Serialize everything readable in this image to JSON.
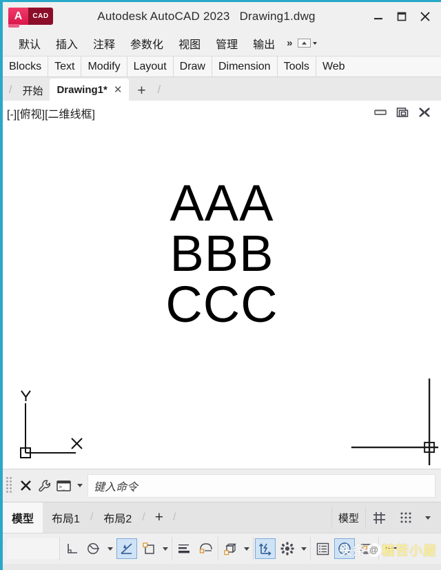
{
  "window": {
    "logo_a": "A",
    "logo_cad": "CAD",
    "app_title": "Autodesk AutoCAD 2023",
    "document_title": "Drawing1.dwg",
    "minimize_label": "minimize",
    "maximize_label": "maximize",
    "close_label": "close"
  },
  "ribbon": {
    "tabs": [
      {
        "label": "默认"
      },
      {
        "label": "插入"
      },
      {
        "label": "注释"
      },
      {
        "label": "参数化"
      },
      {
        "label": "视图"
      },
      {
        "label": "管理"
      },
      {
        "label": "输出"
      }
    ],
    "overflow": "»",
    "panels": [
      {
        "label": "Blocks"
      },
      {
        "label": "Text"
      },
      {
        "label": "Modify"
      },
      {
        "label": "Layout"
      },
      {
        "label": "Draw"
      },
      {
        "label": "Dimension"
      },
      {
        "label": "Tools"
      },
      {
        "label": "Web"
      }
    ]
  },
  "file_tabs": {
    "slash": "/",
    "start_tab": "开始",
    "active_tab": "Drawing1*",
    "close_glyph": "✕",
    "add_glyph": "+"
  },
  "viewport": {
    "label": "[-][俯视][二维线框]",
    "controls": [
      "viewport-minimize",
      "viewport-restore",
      "viewport-close"
    ]
  },
  "drawing": {
    "texts": [
      "AAA",
      "BBB",
      "CCC"
    ],
    "ucs": {
      "x_label": "X",
      "y_label": "Y"
    }
  },
  "command_line": {
    "close_glyph": "✕",
    "placeholder": "键入命令",
    "icons": [
      "grip-dots-icon",
      "close-icon",
      "wrench-icon",
      "terminal-icon",
      "chevron-down-icon"
    ]
  },
  "status_bar": {
    "tabs": [
      {
        "label": "模型",
        "active": true
      },
      {
        "label": "布局1",
        "active": false
      },
      {
        "label": "布局2",
        "active": false
      }
    ],
    "slash": "/",
    "add_glyph": "+",
    "right_label": "模型",
    "right_icons": [
      "grid-icon",
      "snap-dots-icon",
      "chevron-down-icon"
    ]
  },
  "bottom_toolbar": {
    "buttons": [
      {
        "name": "ortho-mode-icon",
        "active": false
      },
      {
        "name": "polar-tracking-icon",
        "active": false
      },
      {
        "name": "polar-tracking-dropdown-icon",
        "active": false
      },
      {
        "name": "object-snap-icon",
        "active": true
      },
      {
        "name": "object-snap-tracking-icon",
        "active": false
      },
      {
        "name": "object-snap-dropdown-icon",
        "active": false
      },
      {
        "name": "lineweight-icon",
        "active": false
      },
      {
        "name": "transparency-icon",
        "active": false
      },
      {
        "name": "3d-object-snap-icon",
        "active": false
      },
      {
        "name": "3d-object-snap-dropdown-icon",
        "active": false
      },
      {
        "name": "dynamic-ucs-icon",
        "active": true
      },
      {
        "name": "selection-cycling-icon",
        "active": false
      },
      {
        "name": "selection-cycling-dropdown-icon",
        "active": false
      },
      {
        "name": "annotation-scale-icon",
        "active": false
      },
      {
        "name": "workspace-icon",
        "active": true
      },
      {
        "name": "hardware-acceleration-icon",
        "active": false
      },
      {
        "name": "clean-screen-icon",
        "active": false
      }
    ]
  },
  "watermark": {
    "prefix": "头条",
    "at": "@",
    "handle": "糖苦小屋"
  },
  "colors": {
    "accent_border": "#29a8c8",
    "logo_red": "#e51a4b",
    "logo_dark_red": "#8c0d28",
    "active_toggle_bg": "#cfe3f7",
    "active_toggle_border": "#7fa8d4",
    "canvas_bg": "#ffffff",
    "chrome_bg": "#f0f0f0"
  }
}
